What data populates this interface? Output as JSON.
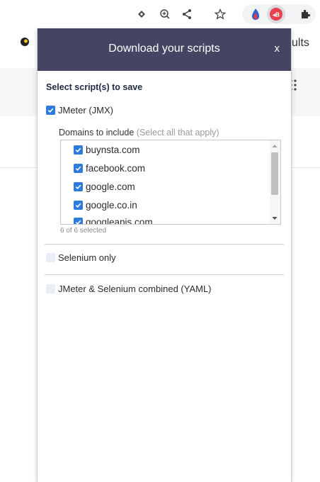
{
  "browser": {
    "toolbar_icons": [
      "install-app-icon",
      "zoom-in-icon",
      "share-icon",
      "bookmark-star-icon",
      "extension-flame-icon",
      "extension-blazemeter-icon",
      "extensions-puzzle-icon"
    ],
    "page_partial_text": "sults",
    "accent_color": "#454563"
  },
  "popup": {
    "title": "Download your scripts",
    "close_label": "x",
    "section_title": "Select script(s) to save",
    "options": {
      "jmeter": {
        "label": "JMeter (JMX)",
        "checked": true
      },
      "selenium": {
        "label": "Selenium only",
        "checked": false
      },
      "combined": {
        "label": "JMeter & Selenium combined (YAML)",
        "checked": false
      }
    },
    "domains": {
      "label": "Domains to include",
      "hint": "(Select all that apply)",
      "items": [
        {
          "label": "buynsta.com",
          "checked": true
        },
        {
          "label": "facebook.com",
          "checked": true
        },
        {
          "label": "google.com",
          "checked": true
        },
        {
          "label": "google.co.in",
          "checked": true
        },
        {
          "label": "googleapis.com",
          "checked": true
        }
      ],
      "count_text": "6 of 6 selected"
    }
  }
}
